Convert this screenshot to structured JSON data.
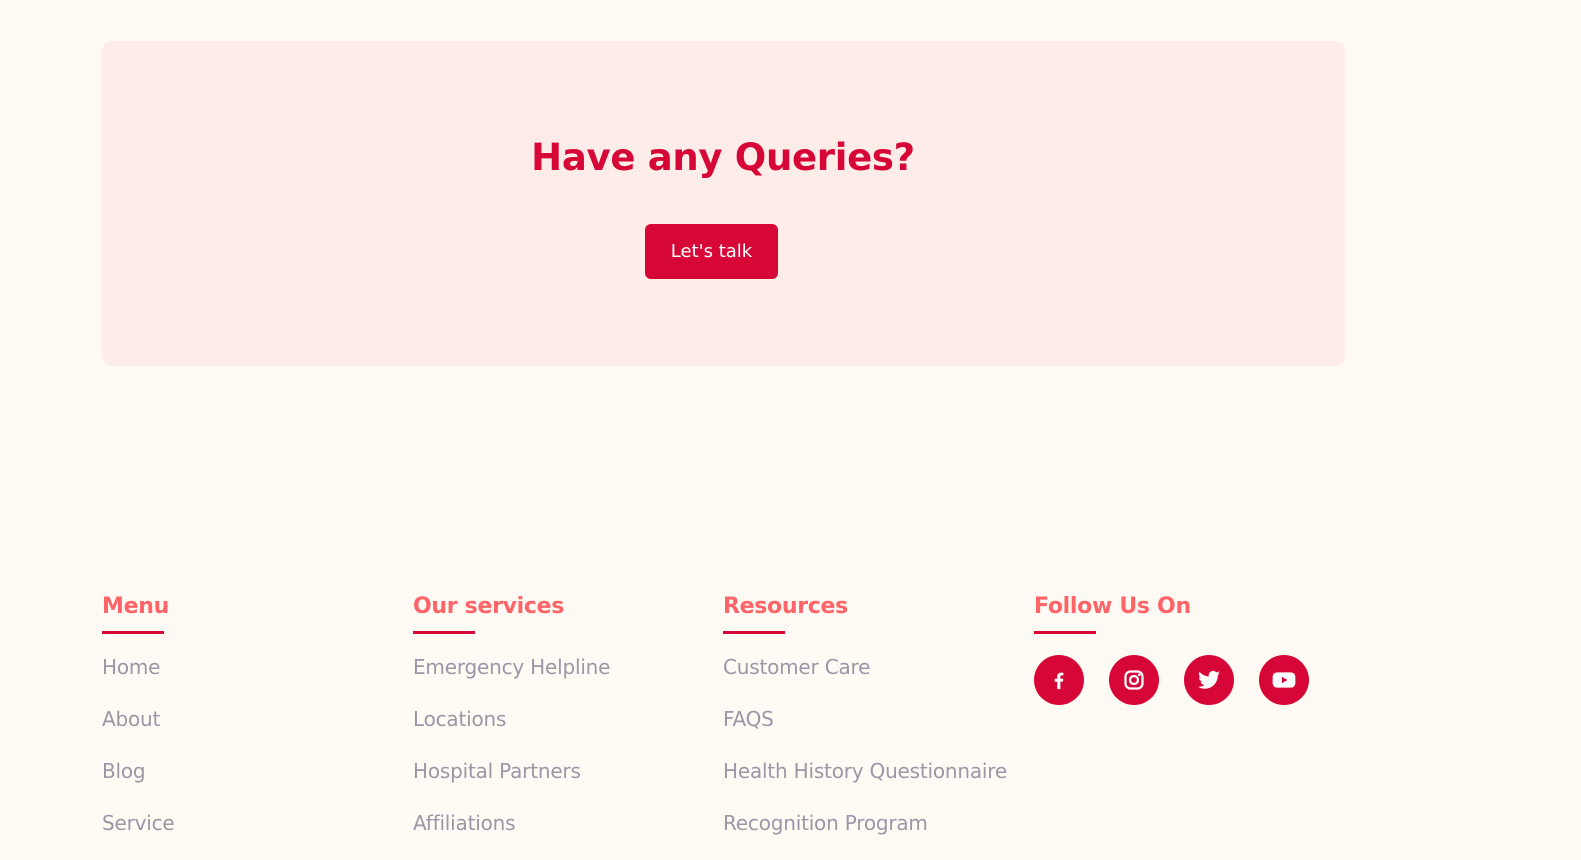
{
  "cta": {
    "title": "Have any Queries?",
    "button_label": "Let's talk"
  },
  "footer": {
    "menu": {
      "heading": "Menu",
      "links": [
        "Home",
        "About",
        "Blog",
        "Service"
      ]
    },
    "services": {
      "heading": "Our services",
      "links": [
        "Emergency Helpline",
        "Locations",
        "Hospital Partners",
        "Affiliations"
      ]
    },
    "resources": {
      "heading": "Resources",
      "links": [
        "Customer Care",
        "FAQS",
        "Health History Questionnaire",
        "Recognition Program"
      ]
    },
    "follow": {
      "heading": "Follow Us On",
      "icons": [
        "facebook-icon",
        "instagram-icon",
        "twitter-icon",
        "youtube-icon"
      ]
    }
  },
  "colors": {
    "background": "#fffaf4",
    "card": "#feece8",
    "primary": "#d60636",
    "heading": "#fe6468",
    "link": "#9a97a6"
  }
}
